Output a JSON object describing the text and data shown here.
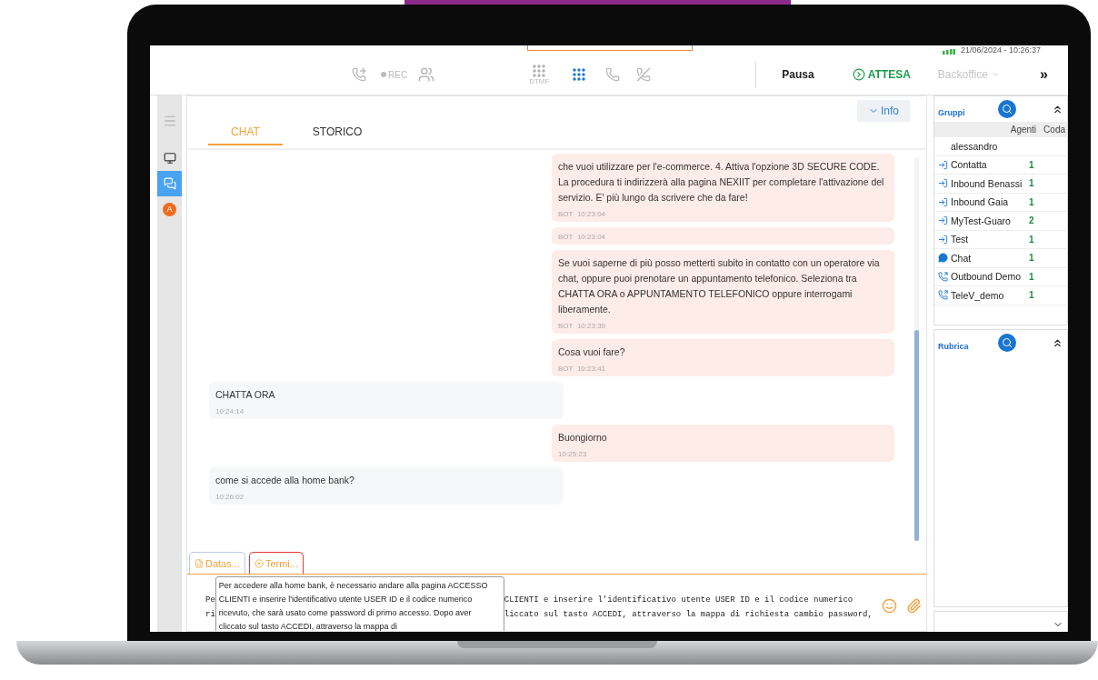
{
  "status_bar": {
    "datetime": "21/06/2024 - 10:26:37"
  },
  "toolbar": {
    "rec_label": "REC",
    "dtmf_label": "DTMF",
    "pause": "Pausa",
    "wait": "ATTESA",
    "backoffice": "Backoffice",
    "more": "»"
  },
  "rail": {
    "items": [
      {
        "kind": "menu",
        "selected": false
      },
      {
        "kind": "monitor",
        "selected": false
      },
      {
        "kind": "chat",
        "selected": true
      },
      {
        "kind": "badge",
        "label": "A",
        "selected": false
      }
    ]
  },
  "chat": {
    "tabs": [
      {
        "label": "CHAT",
        "selected": true
      },
      {
        "label": "STORICO",
        "selected": false
      }
    ],
    "info_button": "Info",
    "messages": [
      {
        "kind": "outgoing",
        "text": "che vuoi utilizzare per l'e-commerce. 4. Attiva l'opzione 3D SECURE CODE. La procedura ti indirizzerà alla pagina NEXIIT per completare l'attivazione del servizio. E' più lungo da scrivere che da fare!",
        "sender": "BOT",
        "time": "10:23:04"
      },
      {
        "kind": "outgoing",
        "sender": "BOT",
        "time": "10:23:04"
      },
      {
        "kind": "outgoing",
        "text": "Se vuoi saperne di più posso metterti subito in contatto con un operatore via chat, oppure puoi prenotare un appuntamento telefonico. Seleziona tra CHATTA ORA o APPUNTAMENTO TELEFONICO oppure interrogami liberamente.",
        "sender": "BOT",
        "time": "10:23:39"
      },
      {
        "kind": "outgoing",
        "text": "Cosa vuoi fare?",
        "sender": "BOT",
        "time": "10:23:41"
      },
      {
        "kind": "incoming",
        "text": "CHATTA ORA",
        "time": "10:24:14"
      },
      {
        "kind": "outgoing",
        "text": "Buongiorno",
        "time": "10:25:23"
      },
      {
        "kind": "incoming",
        "text": "come si accede alla home bank?",
        "time": "10:26:02"
      }
    ],
    "bottom_tabs": [
      {
        "label": "Datas...",
        "kind": "data"
      },
      {
        "label": "Termi...",
        "kind": "end"
      }
    ],
    "input": {
      "lines": [
        {
          "left": "Pe",
          "right": "CLIENTI e inserire l'identificativo utente USER ID e il codice numerico"
        },
        {
          "left": "ri",
          "right": "liccato sul tasto ACCEDI, attraverso la mappa di richiesta cambio password,"
        }
      ]
    },
    "tooltip": "Per accedere alla home bank, è necessario andare alla pagina ACCESSO CLIENTI e inserire l'identificativo utente USER ID e il codice numerico ricevuto, che sarà usato come password di primo accesso. Dopo aver cliccato sul tasto ACCEDI, attraverso la mappa di"
  },
  "groups": {
    "title": "Gruppi",
    "columns": [
      "Agenti",
      "Coda"
    ],
    "rows": [
      {
        "kind": "user",
        "name": "alessandro"
      },
      {
        "kind": "inbound",
        "name": "Contatta",
        "agents": "1"
      },
      {
        "kind": "inbound",
        "name": "Inbound Benassi",
        "agents": "1"
      },
      {
        "kind": "inbound",
        "name": "Inbound Gaia",
        "agents": "1"
      },
      {
        "kind": "inbound",
        "name": "MyTest-Guaro",
        "agents": "2"
      },
      {
        "kind": "inbound",
        "name": "Test",
        "agents": "1"
      },
      {
        "kind": "chat",
        "name": "Chat",
        "agents": "1"
      },
      {
        "kind": "outbound",
        "name": "Outbound Demo",
        "agents": "1"
      },
      {
        "kind": "outbound",
        "name": "TeleV_demo",
        "agents": "1"
      }
    ]
  },
  "contacts": {
    "title": "Rubrica"
  }
}
